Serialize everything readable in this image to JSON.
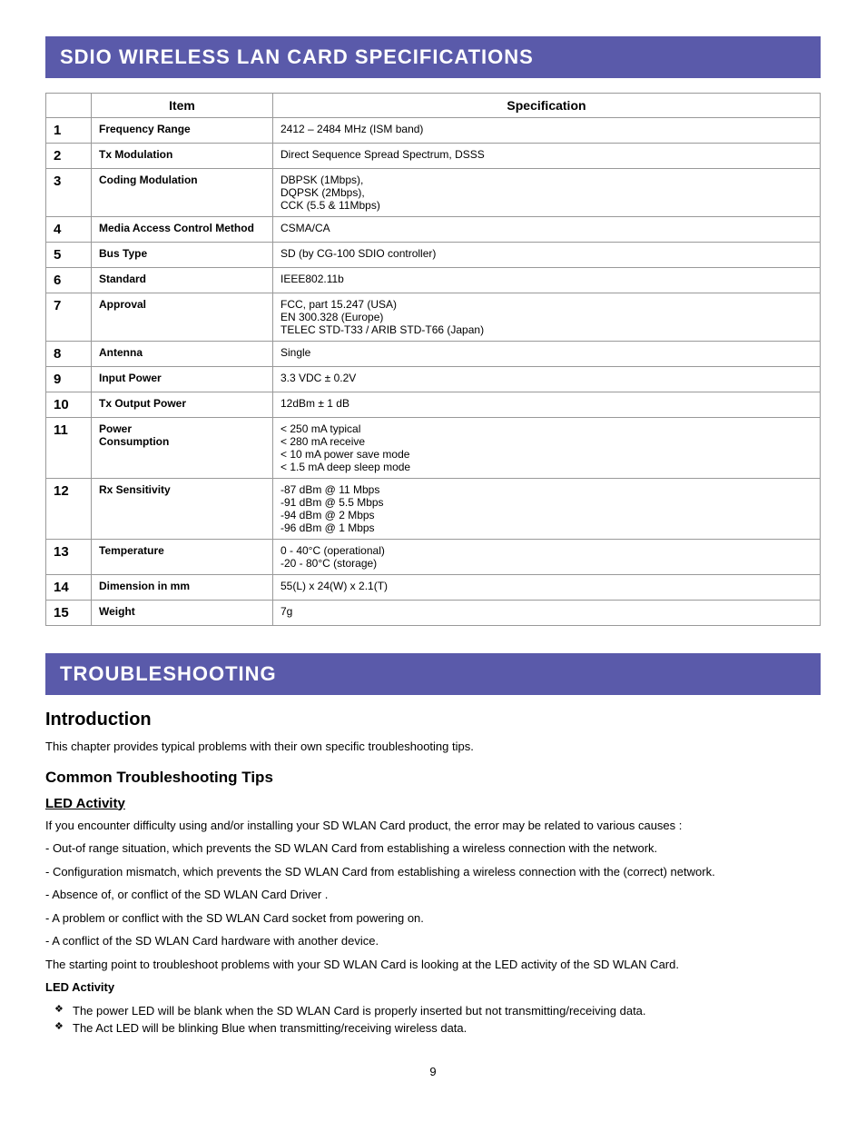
{
  "specs_section": {
    "title": "SDIO WIRELESS LAN CARD SPECIFICATIONS",
    "table": {
      "col1_header": "",
      "col2_header": "Item",
      "col3_header": "Specification",
      "rows": [
        {
          "num": "1",
          "item": "Frequency Range",
          "spec": "2412 – 2484 MHz (ISM band)"
        },
        {
          "num": "2",
          "item": "Tx Modulation",
          "spec": "Direct Sequence Spread Spectrum, DSSS"
        },
        {
          "num": "3",
          "item": "Coding Modulation",
          "spec": "DBPSK (1Mbps),\nDQPSK (2Mbps),\nCCK (5.5 & 11Mbps)"
        },
        {
          "num": "4",
          "item": "Media Access Control Method",
          "spec": "CSMA/CA"
        },
        {
          "num": "5",
          "item": "Bus Type",
          "spec": "SD (by CG-100 SDIO controller)"
        },
        {
          "num": "6",
          "item": "Standard",
          "spec": "IEEE802.11b"
        },
        {
          "num": "7",
          "item": "Approval",
          "spec": "FCC, part 15.247 (USA)\nEN 300.328 (Europe)\nTELEC STD-T33 / ARIB STD-T66 (Japan)"
        },
        {
          "num": "8",
          "item": "Antenna",
          "spec": "Single"
        },
        {
          "num": "9",
          "item": "Input Power",
          "spec": "3.3 VDC ± 0.2V"
        },
        {
          "num": "10",
          "item": "Tx Output Power",
          "spec": "12dBm ± 1 dB"
        },
        {
          "num": "11",
          "item": "Power\nConsumption",
          "spec": "< 250 mA typical\n< 280 mA receive\n< 10 mA power save mode\n< 1.5 mA deep sleep mode"
        },
        {
          "num": "12",
          "item": "Rx Sensitivity",
          "spec": "-87 dBm @ 11 Mbps\n-91 dBm @ 5.5 Mbps\n-94 dBm @ 2 Mbps\n-96 dBm @ 1 Mbps"
        },
        {
          "num": "13",
          "item": "Temperature",
          "spec": "0 - 40°C (operational)\n-20 - 80°C (storage)"
        },
        {
          "num": "14",
          "item": "Dimension in mm",
          "spec": "55(L) x 24(W) x 2.1(T)"
        },
        {
          "num": "15",
          "item": "Weight",
          "spec": "7g"
        }
      ]
    }
  },
  "troubleshooting_section": {
    "title": "TROUBLESHOOTING",
    "intro_title": "Introduction",
    "intro_text": "This chapter provides typical problems with their own specific troubleshooting tips.",
    "common_title": "Common Troubleshooting Tips",
    "led_title": "LED Activity",
    "led_paragraphs": [
      "If you encounter difficulty using and/or installing your SD WLAN Card product, the error may be related to various causes :",
      "- Out-of range situation, which prevents the SD WLAN Card from establishing a wireless connection with the network.",
      "- Configuration mismatch, which prevents the SD WLAN Card from establishing a wireless connection with the (correct) network.",
      "- Absence of, or conflict of the SD WLAN Card Driver .",
      "- A problem or conflict with the SD WLAN Card socket from powering on.",
      "- A conflict of the SD WLAN Card hardware with another device.",
      "The starting point to troubleshoot problems with your SD WLAN Card is looking at the LED activity of the SD WLAN Card."
    ],
    "led_activity_label": "LED Activity",
    "bullet_points": [
      "The power LED will be blank when the SD WLAN Card is properly inserted but not transmitting/receiving data.",
      "The Act LED will be blinking Blue when transmitting/receiving wireless data."
    ]
  },
  "page_number": "9"
}
